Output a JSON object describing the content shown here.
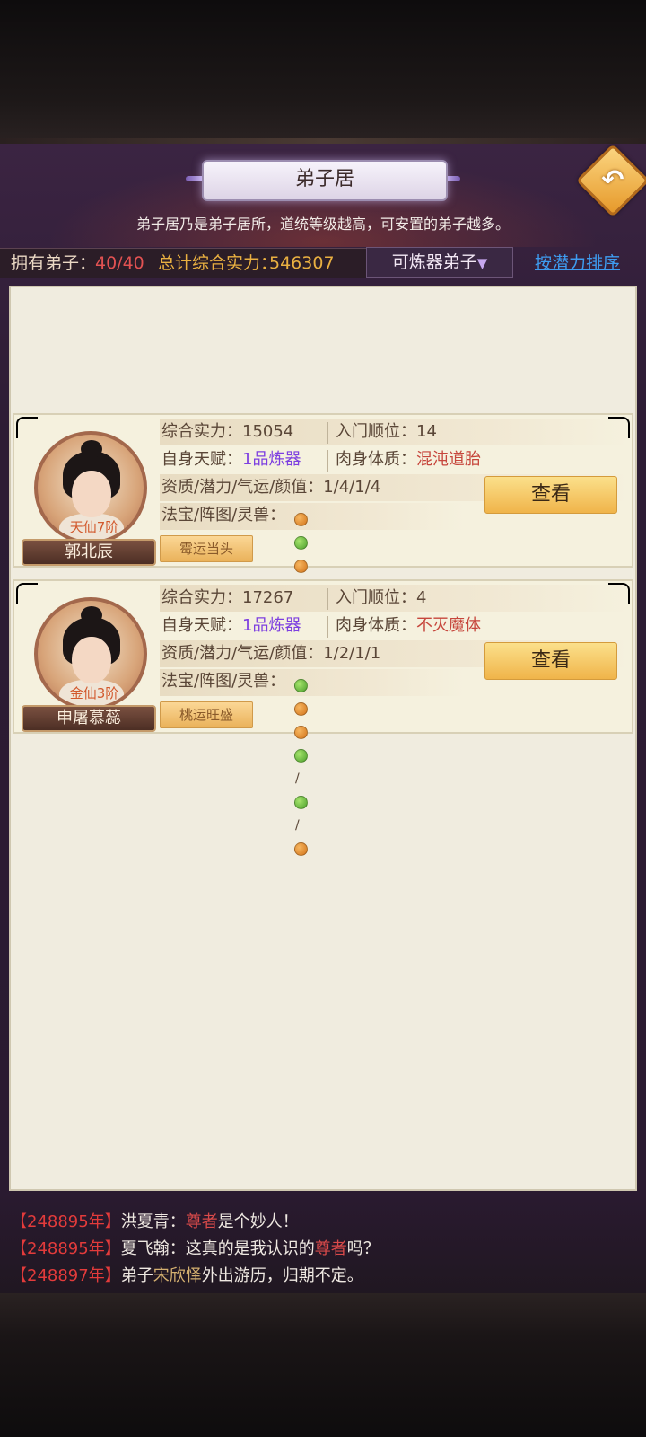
{
  "header": {
    "title": "弟子居",
    "back_icon": "back-arrow-icon",
    "subtitle": "弟子居乃是弟子居所，道统等级越高，可安置的弟子越多。"
  },
  "stats": {
    "disciples_label": "拥有弟子：",
    "disciples_value": "40/40",
    "power_label": "总计综合实力：",
    "power_value": "546307"
  },
  "filter": {
    "selected": "可炼器弟子",
    "arrow": "▼"
  },
  "sort_label": "按潜力排序",
  "labels": {
    "power": "综合实力：",
    "order": "入门顺位：",
    "talent": "自身天赋：",
    "body": "肉身体质：",
    "attrs": "资质/潜力/气运/颜值：",
    "treasure": "法宝/阵图/灵兽：",
    "view": "查看"
  },
  "disciples": [
    {
      "name": "郭北辰",
      "rank": "天仙7阶",
      "power": "15054",
      "order": "14",
      "talent": "1品炼器",
      "body": "混沌道胎",
      "attrs": "1/4/1/4",
      "fortune": "霉运当头",
      "treasure_dots": [
        "orange",
        "green",
        "orange",
        "green",
        "green",
        "green"
      ]
    },
    {
      "name": "申屠慕蕊",
      "rank": "金仙3阶",
      "power": "17267",
      "order": "4",
      "talent": "1品炼器",
      "body": "不灭魔体",
      "attrs": "1/2/1/1",
      "fortune": "桃运旺盛",
      "treasure_dots": [
        "green",
        "orange",
        "orange",
        "green",
        "green",
        "orange"
      ]
    }
  ],
  "log": [
    {
      "open": "【",
      "year": "248895年",
      "close": "】",
      "name": "洪夏青",
      "text1": "：",
      "hl": "尊者",
      "text2": "是个妙人！"
    },
    {
      "open": "【",
      "year": "248895年",
      "close": "】",
      "name": "夏飞翰",
      "text1": "：这真的是我认识的",
      "hl": "尊者",
      "text2": "吗？"
    },
    {
      "open": "【",
      "year": "248897年",
      "close": "】",
      "name": "弟子",
      "hl": "宋欣怿",
      "text2": "外出游历，归期不定。"
    }
  ]
}
